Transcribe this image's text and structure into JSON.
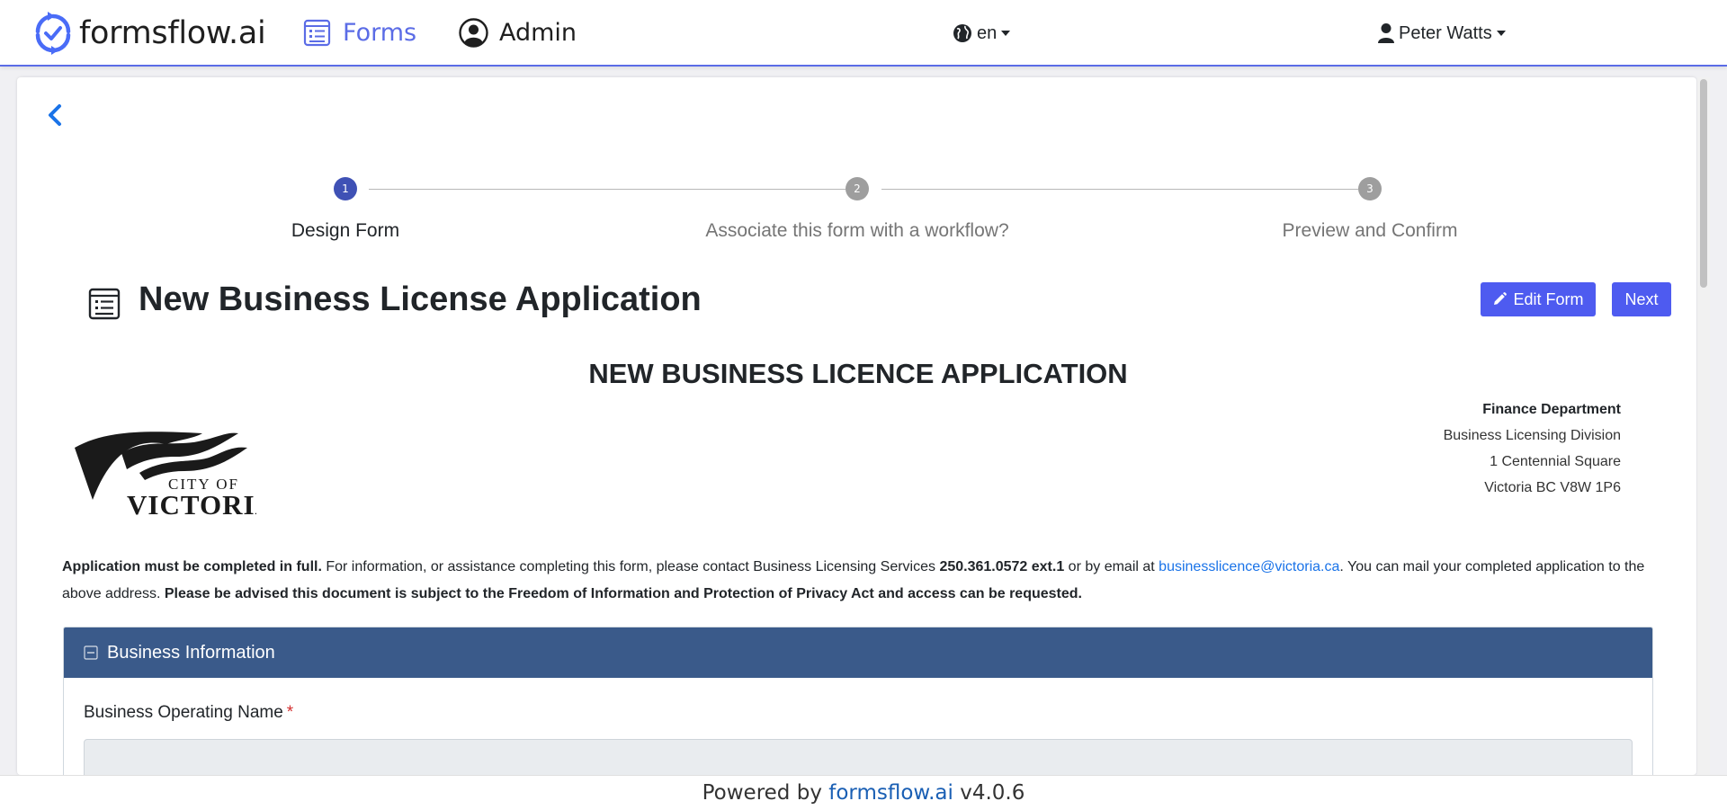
{
  "navbar": {
    "brand": "formsflow.ai",
    "forms_label": "Forms",
    "admin_label": "Admin",
    "language": "en",
    "user_name": "Peter Watts"
  },
  "stepper": {
    "steps": [
      {
        "number": "1",
        "label": "Design Form",
        "active": true
      },
      {
        "number": "2",
        "label": "Associate this form with a workflow?",
        "active": false
      },
      {
        "number": "3",
        "label": "Preview and Confirm",
        "active": false
      }
    ]
  },
  "form_header": {
    "title": "New Business License Application",
    "edit_label": "Edit Form",
    "next_label": "Next"
  },
  "form_body": {
    "heading": "NEW BUSINESS LICENCE APPLICATION",
    "address": {
      "department": "Finance Department",
      "division": "Business Licensing Division",
      "street": "1 Centennial Square",
      "city": "Victoria BC V8W 1P6"
    },
    "logo_text": {
      "line1": "CITY OF",
      "line2": "VICTORIA"
    },
    "info": {
      "bold_intro": "Application must be completed in full.",
      "text1": " For information, or assistance completing this form, please contact Business Licensing Services ",
      "phone": "250.361.0572 ext.1",
      "text2": " or by email at ",
      "email": "businesslicence@victoria.ca",
      "text3": ". You can mail your completed application to the above address. ",
      "bold_notice": "Please be advised this document is subject to the Freedom of Information and Protection of Privacy Act and access can be requested."
    },
    "panel": {
      "title": "Business Information",
      "field_label": "Business Operating Name",
      "required_mark": "*",
      "field_value": ""
    }
  },
  "footer": {
    "prefix": "Powered by ",
    "brand": "formsflow.ai",
    "version": " v4.0.6"
  },
  "colors": {
    "accent": "#4e5bf0",
    "nav_active": "#5b6ce6",
    "step_active": "#3f51b5",
    "panel_header": "#3a5a8a"
  }
}
